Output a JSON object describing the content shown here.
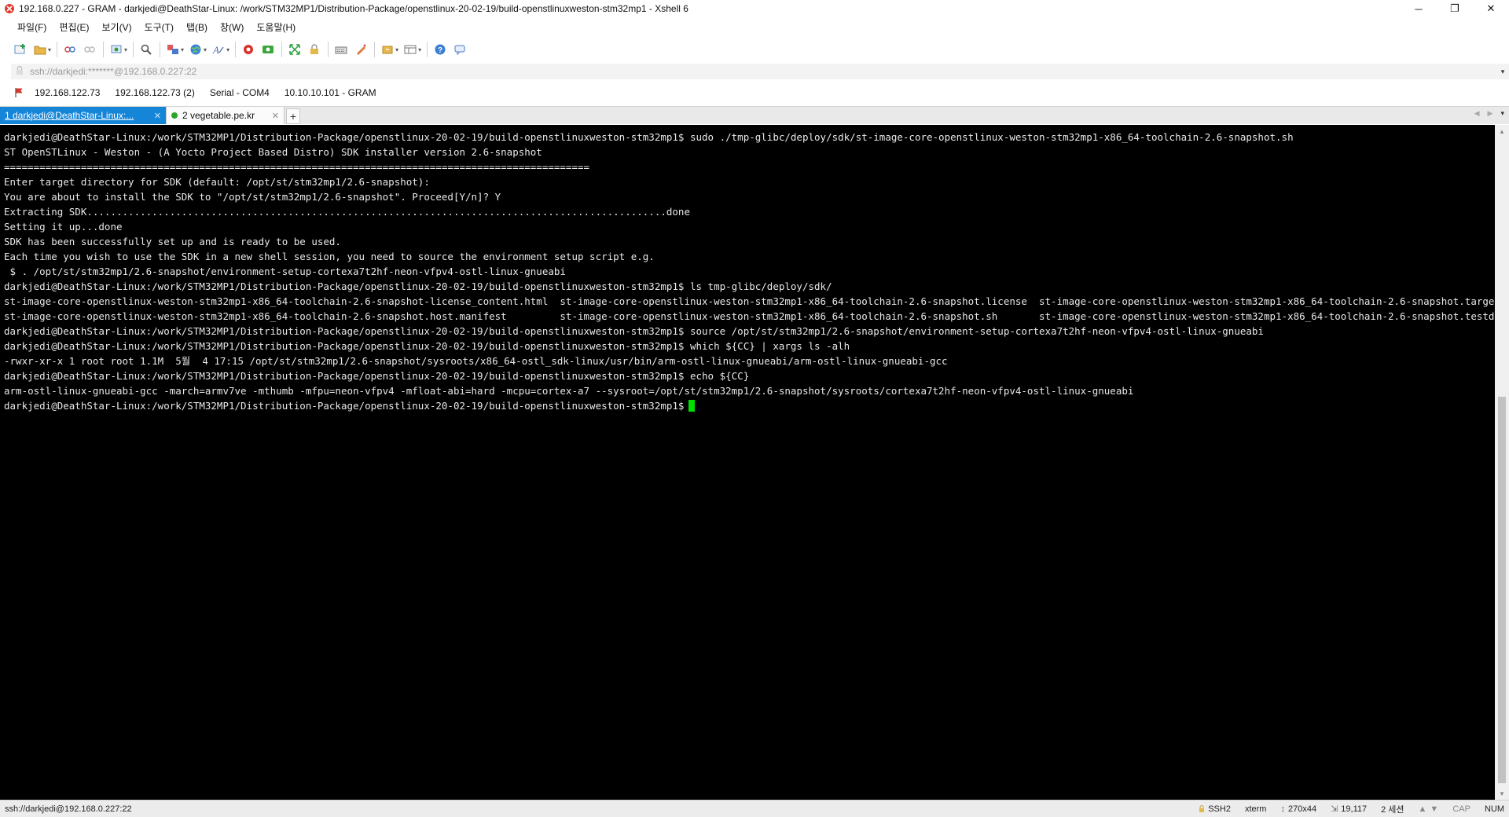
{
  "window": {
    "title": "192.168.0.227 - GRAM - darkjedi@DeathStar-Linux: /work/STM32MP1/Distribution-Package/openstlinux-20-02-19/build-openstlinuxweston-stm32mp1 - Xshell 6",
    "minimize": "─",
    "restore": "❐",
    "close": "✕"
  },
  "menu": [
    "파일(F)",
    "편집(E)",
    "보기(V)",
    "도구(T)",
    "탭(B)",
    "창(W)",
    "도움말(H)"
  ],
  "toolbar": {
    "icons": [
      "new-session-icon",
      "open-folder-icon",
      "link-icon",
      "unlink-icon",
      "reconnect-icon",
      "find-icon",
      "transfer-icon",
      "globe-icon",
      "font-icon",
      "xftp-icon",
      "xmanager-icon",
      "fullscreen-icon",
      "lock-icon",
      "keyboard-icon",
      "script-icon",
      "compose-icon",
      "layout-icon",
      "help-icon",
      "chat-icon"
    ]
  },
  "address": {
    "value": "ssh://darkjedi:*******@192.168.0.227:22"
  },
  "links": [
    "192.168.122.73",
    "192.168.122.73 (2)",
    "Serial - COM4",
    "10.10.10.101 - GRAM"
  ],
  "tabs": [
    {
      "label": "1 darkjedi@DeathStar-Linux:...",
      "active": true
    },
    {
      "label": "2 vegetable.pe.kr",
      "active": false
    }
  ],
  "terminal": {
    "lines": [
      "darkjedi@DeathStar-Linux:/work/STM32MP1/Distribution-Package/openstlinux-20-02-19/build-openstlinuxweston-stm32mp1$ sudo ./tmp-glibc/deploy/sdk/st-image-core-openstlinux-weston-stm32mp1-x86_64-toolchain-2.6-snapshot.sh",
      "ST OpenSTLinux - Weston - (A Yocto Project Based Distro) SDK installer version 2.6-snapshot",
      "===================================================================================================",
      "Enter target directory for SDK (default: /opt/st/stm32mp1/2.6-snapshot):",
      "You are about to install the SDK to \"/opt/st/stm32mp1/2.6-snapshot\". Proceed[Y/n]? Y",
      "Extracting SDK..................................................................................................done",
      "Setting it up...done",
      "SDK has been successfully set up and is ready to be used.",
      "Each time you wish to use the SDK in a new shell session, you need to source the environment setup script e.g.",
      " $ . /opt/st/stm32mp1/2.6-snapshot/environment-setup-cortexa7t2hf-neon-vfpv4-ostl-linux-gnueabi",
      "darkjedi@DeathStar-Linux:/work/STM32MP1/Distribution-Package/openstlinux-20-02-19/build-openstlinuxweston-stm32mp1$ ls tmp-glibc/deploy/sdk/",
      "st-image-core-openstlinux-weston-stm32mp1-x86_64-toolchain-2.6-snapshot-license_content.html  st-image-core-openstlinux-weston-stm32mp1-x86_64-toolchain-2.6-snapshot.license  st-image-core-openstlinux-weston-stm32mp1-x86_64-toolchain-2.6-snapshot.target.manifest",
      "st-image-core-openstlinux-weston-stm32mp1-x86_64-toolchain-2.6-snapshot.host.manifest         st-image-core-openstlinux-weston-stm32mp1-x86_64-toolchain-2.6-snapshot.sh       st-image-core-openstlinux-weston-stm32mp1-x86_64-toolchain-2.6-snapshot.testdata.json",
      "darkjedi@DeathStar-Linux:/work/STM32MP1/Distribution-Package/openstlinux-20-02-19/build-openstlinuxweston-stm32mp1$ source /opt/st/stm32mp1/2.6-snapshot/environment-setup-cortexa7t2hf-neon-vfpv4-ostl-linux-gnueabi",
      "darkjedi@DeathStar-Linux:/work/STM32MP1/Distribution-Package/openstlinux-20-02-19/build-openstlinuxweston-stm32mp1$ which ${CC} | xargs ls -alh",
      "-rwxr-xr-x 1 root root 1.1M  5월  4 17:15 /opt/st/stm32mp1/2.6-snapshot/sysroots/x86_64-ostl_sdk-linux/usr/bin/arm-ostl-linux-gnueabi/arm-ostl-linux-gnueabi-gcc",
      "darkjedi@DeathStar-Linux:/work/STM32MP1/Distribution-Package/openstlinux-20-02-19/build-openstlinuxweston-stm32mp1$ echo ${CC}",
      "arm-ostl-linux-gnueabi-gcc -march=armv7ve -mthumb -mfpu=neon-vfpv4 -mfloat-abi=hard -mcpu=cortex-a7 --sysroot=/opt/st/stm32mp1/2.6-snapshot/sysroots/cortexa7t2hf-neon-vfpv4-ostl-linux-gnueabi",
      "darkjedi@DeathStar-Linux:/work/STM32MP1/Distribution-Package/openstlinux-20-02-19/build-openstlinuxweston-stm32mp1$"
    ]
  },
  "status": {
    "connection": "ssh://darkjedi@192.168.0.227:22",
    "protocol": "SSH2",
    "term": "xterm",
    "size": "270x44",
    "cursor_pos": "19,117",
    "sessions": "2 세션",
    "caps": "CAP",
    "num": "NUM"
  },
  "colors": {
    "accent": "#1585d8",
    "terminal_bg": "#000000",
    "terminal_fg": "#e8e8e8",
    "cursor": "#00e000"
  }
}
